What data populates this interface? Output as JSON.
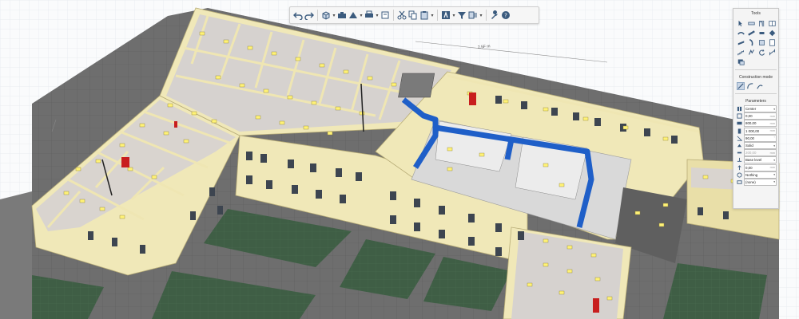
{
  "scene": {
    "dimension_label": "2.5F m",
    "colors": {
      "wall": "#f0e8b8",
      "roof_edge": "#e9dfa8",
      "floor_room": "#d8d4d4",
      "window_light": "#fff276",
      "duct": "#1f5fc8",
      "door_red": "#c81e1e",
      "grass": "#3f5e45",
      "pavement": "#6b6b6b",
      "grid": "#dde3ea"
    }
  },
  "toolbar": {
    "items": [
      {
        "name": "undo-icon",
        "dropdown": false
      },
      {
        "name": "redo-icon",
        "dropdown": false
      },
      {
        "name": "view-cube-icon",
        "dropdown": true
      },
      {
        "name": "camera-icon",
        "dropdown": false
      },
      {
        "name": "perspective-icon",
        "dropdown": true
      },
      {
        "name": "print-icon",
        "dropdown": true
      },
      {
        "name": "print2-icon",
        "dropdown": false
      },
      {
        "name": "cut-icon",
        "dropdown": false
      },
      {
        "name": "copy-icon",
        "dropdown": false
      },
      {
        "name": "paste-icon",
        "dropdown": true
      },
      {
        "name": "text-icon",
        "dropdown": true
      },
      {
        "name": "filter-icon",
        "dropdown": false
      },
      {
        "name": "layers-icon",
        "dropdown": true
      },
      {
        "name": "wrench-icon",
        "dropdown": false
      },
      {
        "name": "help-icon",
        "dropdown": false
      }
    ]
  },
  "panel": {
    "tools_title": "Tools",
    "tools": [
      "select-icon",
      "wall-icon",
      "door-icon",
      "window-icon",
      "pipe-icon",
      "duct-icon",
      "fitting-icon",
      "terminal-icon",
      "beam-icon",
      "column-icon",
      "slab-icon",
      "room-icon",
      "stair-icon",
      "route-icon",
      "rotate-icon",
      "measure-icon",
      "annotation-icon"
    ],
    "construction_mode_title": "Construction mode",
    "modes": [
      "line-mode-icon",
      "arc-mode-icon",
      "curve-mode-icon"
    ],
    "parameters_title": "Parameters",
    "params": [
      {
        "icon": "alignment-icon",
        "value": "Center",
        "unit": "",
        "dropdown": true
      },
      {
        "icon": "offset-icon",
        "value": "0,00",
        "unit": "mm",
        "dropdown": false
      },
      {
        "icon": "width-icon",
        "value": "800,00",
        "unit": "mm",
        "dropdown": false
      },
      {
        "icon": "height-icon",
        "value": "1 000,00",
        "unit": "mm",
        "dropdown": false
      },
      {
        "icon": "angle-icon",
        "value": "90,00",
        "unit": "°",
        "dropdown": false
      },
      {
        "icon": "type-icon",
        "value": "Solid",
        "unit": "",
        "dropdown": true
      },
      {
        "icon": "thickness-icon",
        "value": "200,00",
        "unit": "mm",
        "dropdown": false,
        "dim": true
      },
      {
        "icon": "level-icon",
        "value": "Base level",
        "unit": "",
        "dropdown": true
      },
      {
        "icon": "elevation-icon",
        "value": "0,00",
        "unit": "mm",
        "dropdown": false
      },
      {
        "icon": "insulation-icon",
        "value": "Nothing",
        "unit": "",
        "dropdown": true
      },
      {
        "icon": "system-icon",
        "value": "(none)",
        "unit": "",
        "dropdown": true
      }
    ]
  }
}
